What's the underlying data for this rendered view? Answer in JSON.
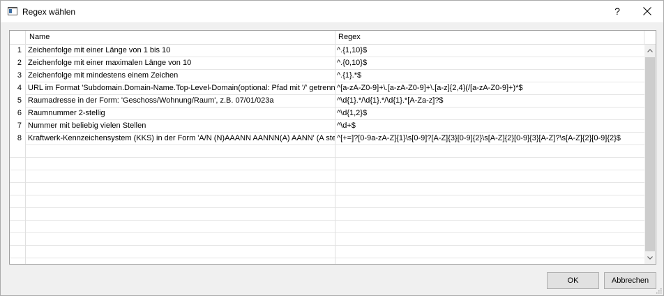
{
  "window": {
    "title": "Regex wählen",
    "help_label": "?"
  },
  "table": {
    "columns": [
      "Name",
      "Regex"
    ],
    "rows": [
      {
        "num": "1",
        "name": "Zeichenfolge mit einer Länge von 1 bis 10",
        "regex": "^.{1,10}$"
      },
      {
        "num": "2",
        "name": "Zeichenfolge mit einer maximalen Länge von 10",
        "regex": "^.{0,10}$"
      },
      {
        "num": "3",
        "name": "Zeichenfolge mit mindestens einem Zeichen",
        "regex": "^.{1}.*$"
      },
      {
        "num": "4",
        "name": "URL im Format 'Subdomain.Domain-Name.Top-Level-Domain(optional: Pfad mit '/' getrennt)'",
        "regex": "^[a-zA-Z0-9]+\\.[a-zA-Z0-9]+\\.[a-z]{2,4}(/[a-zA-Z0-9]+)*$"
      },
      {
        "num": "5",
        "name": "Raumadresse in der Form: 'Geschoss/Wohnung/Raum', z.B. 07/01/023a",
        "regex": "^\\d{1}.*/\\d{1}.*/\\d{1}.*[A-Za-z]?$"
      },
      {
        "num": "6",
        "name": "Raumnummer 2-stellig",
        "regex": "^\\d{1,2}$"
      },
      {
        "num": "7",
        "name": "Nummer mit beliebig vielen Stellen",
        "regex": "^\\d+$"
      },
      {
        "num": "8",
        "name": "Kraftwerk-Kennzeichensystem (KKS) in der Form 'A/N (N)AAANN AANNN(A) AANN' (A steh...",
        "regex": "^[+=]?[0-9a-zA-Z]{1}\\s[0-9]?[A-Z]{3}[0-9]{2}\\s[A-Z]{2}[0-9]{3}[A-Z]?\\s[A-Z]{2}[0-9]{2}$"
      }
    ]
  },
  "buttons": {
    "ok": "OK",
    "cancel": "Abbrechen"
  }
}
